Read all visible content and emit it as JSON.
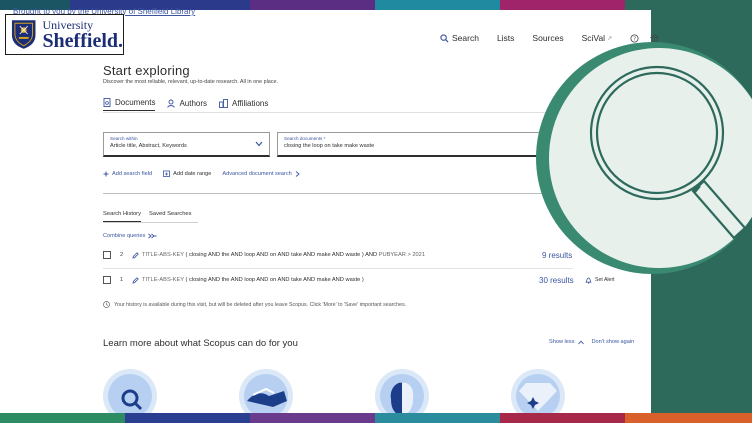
{
  "banner": {
    "notice": "Brought to you by the University of Sheffield Library",
    "logo_line1": "The",
    "logo_line2": "University",
    "logo_line3": "Of",
    "logo_line4": "Sheffield."
  },
  "nav": {
    "search": "Search",
    "lists": "Lists",
    "sources": "Sources",
    "scival": "SciVal"
  },
  "header": {
    "title": "Start exploring",
    "subtitle": "Discover the most reliable, relevant, up-to-date research. All in one place."
  },
  "tabs": [
    "Documents",
    "Authors",
    "Affiliations"
  ],
  "search": {
    "within_label": "Search within",
    "within_value": "Article title, Abstract, Keywords",
    "documents_label": "Search documents *",
    "documents_value": "closing the loop on take make waste"
  },
  "actions": {
    "add_field": "Add search field",
    "add_date": "Add date range",
    "advanced": "Advanced document search"
  },
  "history": {
    "tab_history": "Search History",
    "tab_saved": "Saved Searches",
    "combine": "Combine queries",
    "rows": [
      {
        "num": "2",
        "prefix": "TITLE-ABS-KEY",
        "query": "( closing AND the AND loop AND on AND take AND make AND waste ) AND",
        "suffix": "PUBYEAR > 2021",
        "results": "9 results",
        "alert": ""
      },
      {
        "num": "1",
        "prefix": "TITLE-ABS-KEY",
        "query": "( closing AND the AND loop AND on AND take AND make AND waste )",
        "suffix": "",
        "results": "30 results",
        "alert": "Set Alert"
      }
    ],
    "note": "Your history is available during this visit, but will be deleted after you leave Scopus. Click 'More' to 'Save' important searches."
  },
  "learn": {
    "title": "Learn more about what Scopus can do for you",
    "show_less": "Show less",
    "dont_show": "Don't show again"
  },
  "colors": {
    "brand": "#3b55a0",
    "overlay_green": "#2e6a5c",
    "logo_blue": "#1c2d78"
  }
}
